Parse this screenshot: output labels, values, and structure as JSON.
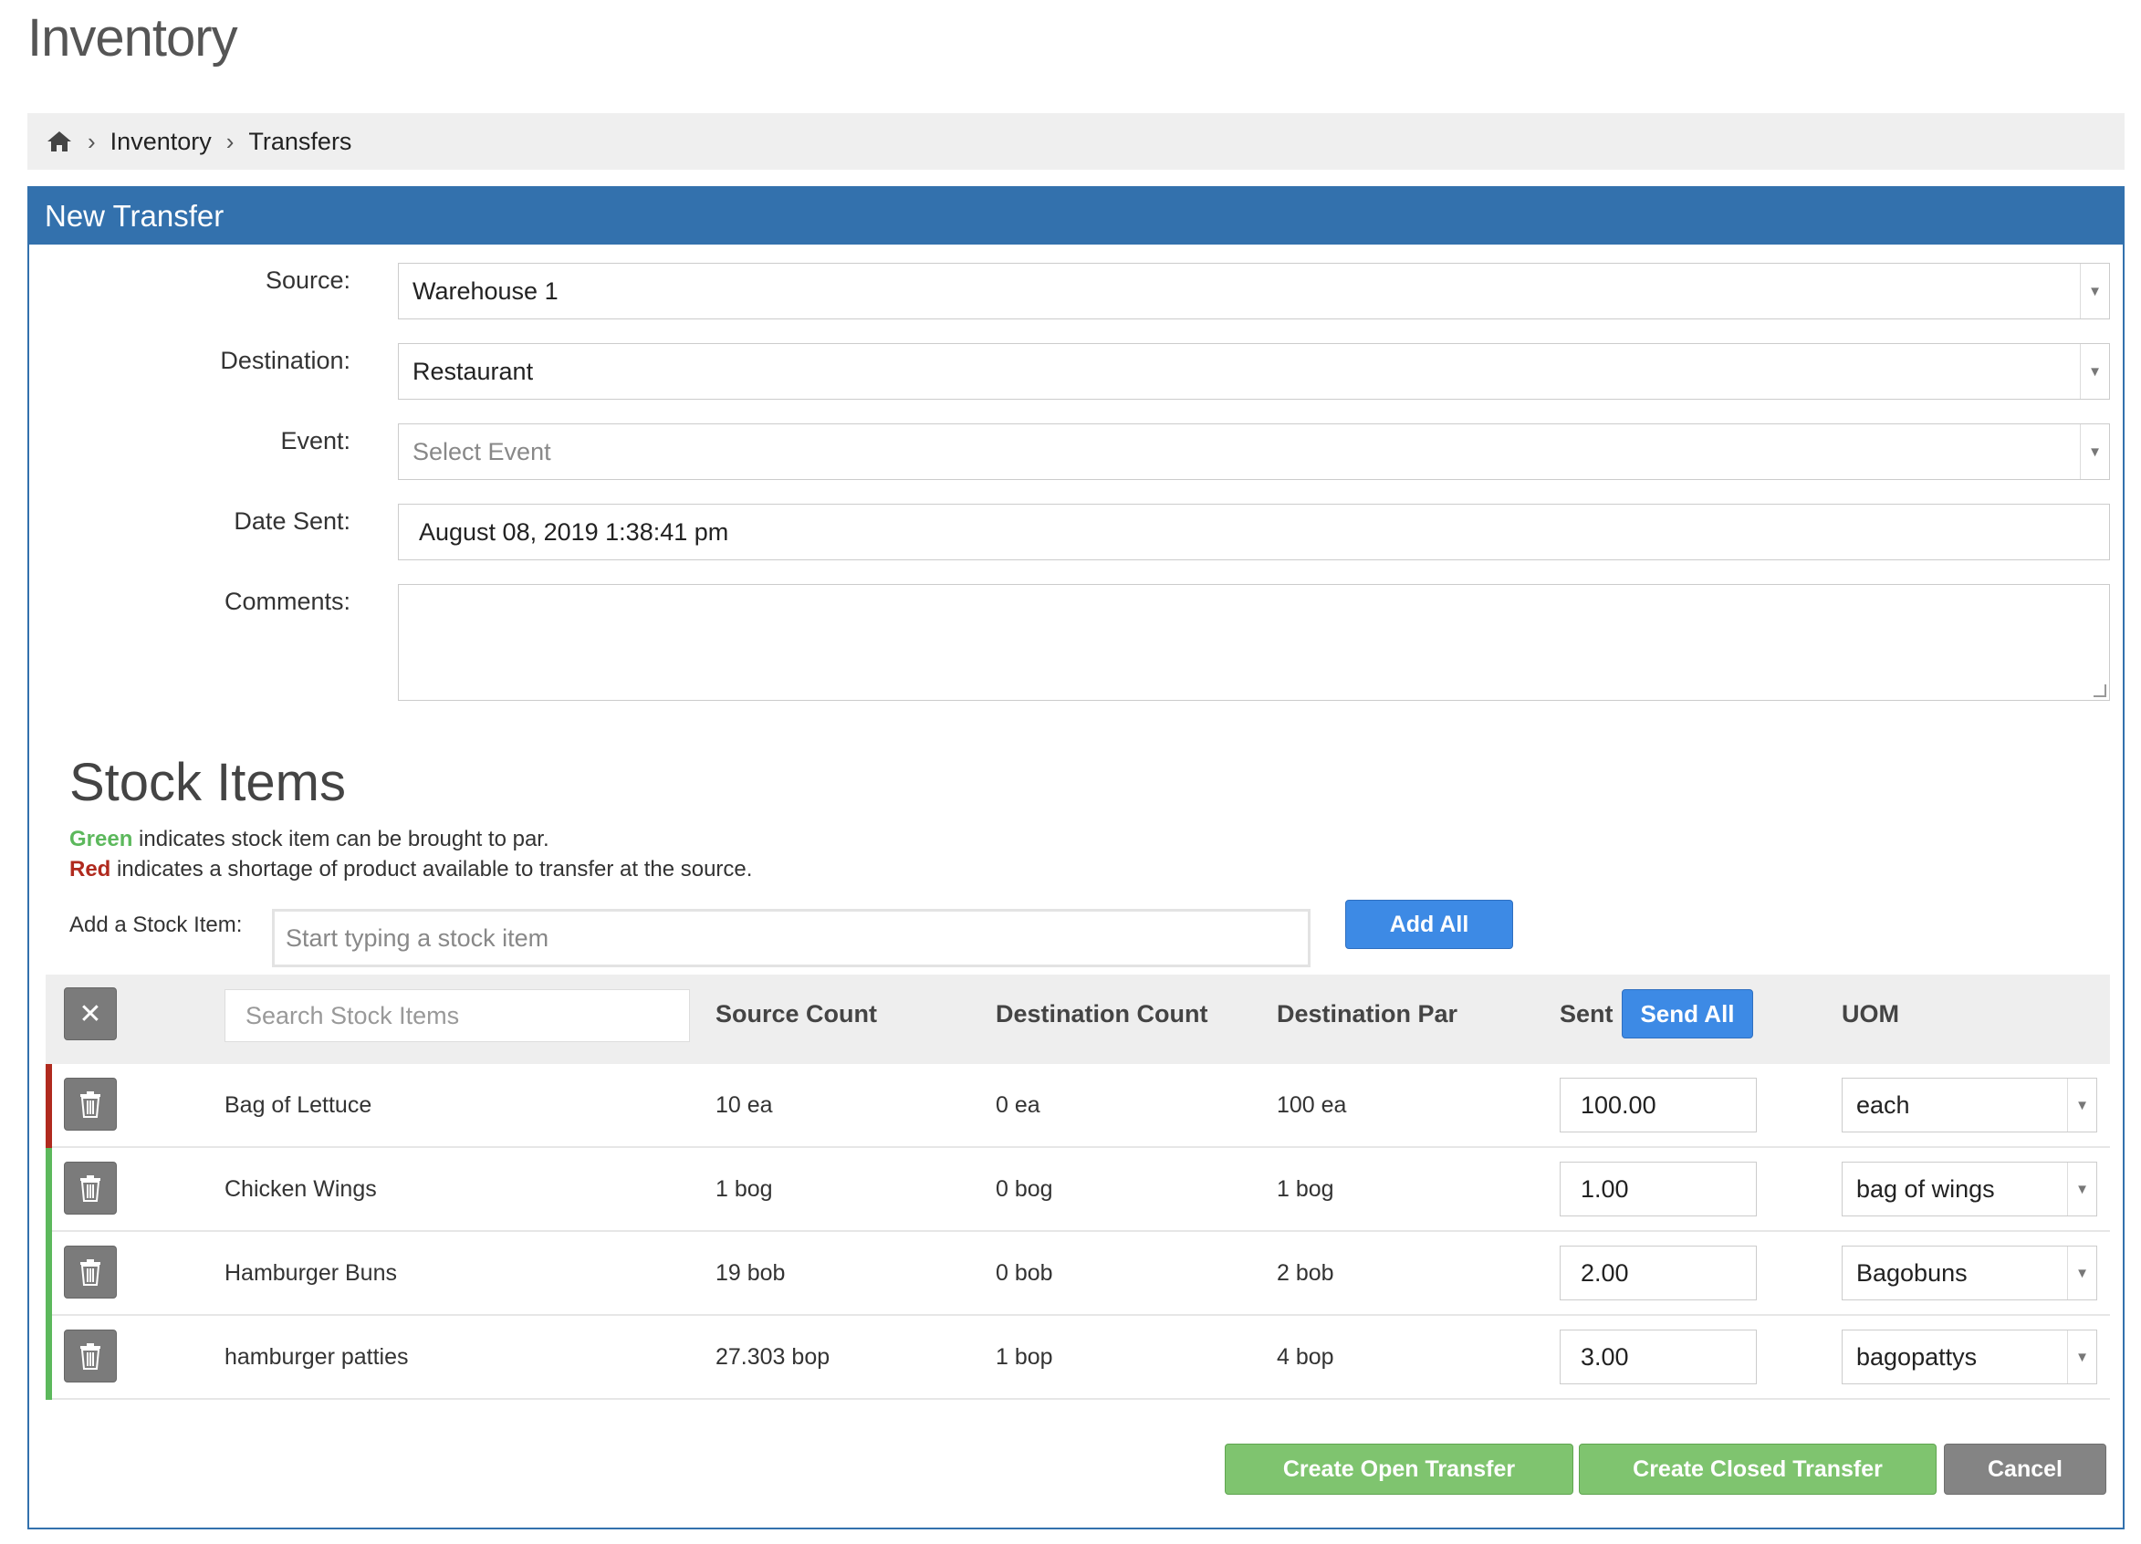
{
  "page": {
    "title": "Inventory"
  },
  "breadcrumb": {
    "home_icon": "home-icon",
    "items": [
      "Inventory",
      "Transfers"
    ]
  },
  "panel": {
    "title": "New Transfer"
  },
  "form": {
    "source": {
      "label": "Source:",
      "value": "Warehouse 1"
    },
    "destination": {
      "label": "Destination:",
      "value": "Restaurant"
    },
    "event": {
      "label": "Event:",
      "placeholder": "Select Event"
    },
    "date_sent": {
      "label": "Date Sent:",
      "value": "August 08, 2019 1:38:41 pm"
    },
    "comments": {
      "label": "Comments:",
      "value": ""
    }
  },
  "stock_items": {
    "title": "Stock Items",
    "legend": {
      "green_word": "Green",
      "green_text": " indicates stock item can be brought to par.",
      "red_word": "Red",
      "red_text": " indicates a shortage of product available to transfer at the source."
    },
    "add_label": "Add a Stock Item:",
    "add_placeholder": "Start typing a stock item",
    "add_all_label": "Add All",
    "search_placeholder": "Search Stock Items",
    "columns": {
      "source_count": "Source Count",
      "destination_count": "Destination Count",
      "destination_par": "Destination Par",
      "sent": "Sent",
      "send_all": "Send All",
      "uom": "UOM"
    },
    "rows": [
      {
        "name": "Bag of Lettuce",
        "source_count": "10 ea",
        "destination_count": "0 ea",
        "destination_par": "100 ea",
        "sent": "100.00",
        "uom": "each",
        "status": "red"
      },
      {
        "name": "Chicken Wings",
        "source_count": "1 bog",
        "destination_count": "0 bog",
        "destination_par": "1 bog",
        "sent": "1.00",
        "uom": "bag of wings",
        "status": "green"
      },
      {
        "name": "Hamburger Buns",
        "source_count": "19 bob",
        "destination_count": "0 bob",
        "destination_par": "2 bob",
        "sent": "2.00",
        "uom": "Bagobuns",
        "status": "green"
      },
      {
        "name": "hamburger patties",
        "source_count": "27.303 bop",
        "destination_count": "1 bop",
        "destination_par": "4 bop",
        "sent": "3.00",
        "uom": "bagopattys",
        "status": "green"
      }
    ]
  },
  "actions": {
    "create_open": "Create Open Transfer",
    "create_closed": "Create Closed Transfer",
    "cancel": "Cancel"
  },
  "colors": {
    "accent": "#3371ad",
    "button_blue": "#3d8ae5",
    "button_green": "#7fc46f",
    "status_green": "#5cb85c",
    "status_red": "#b02a1e"
  }
}
